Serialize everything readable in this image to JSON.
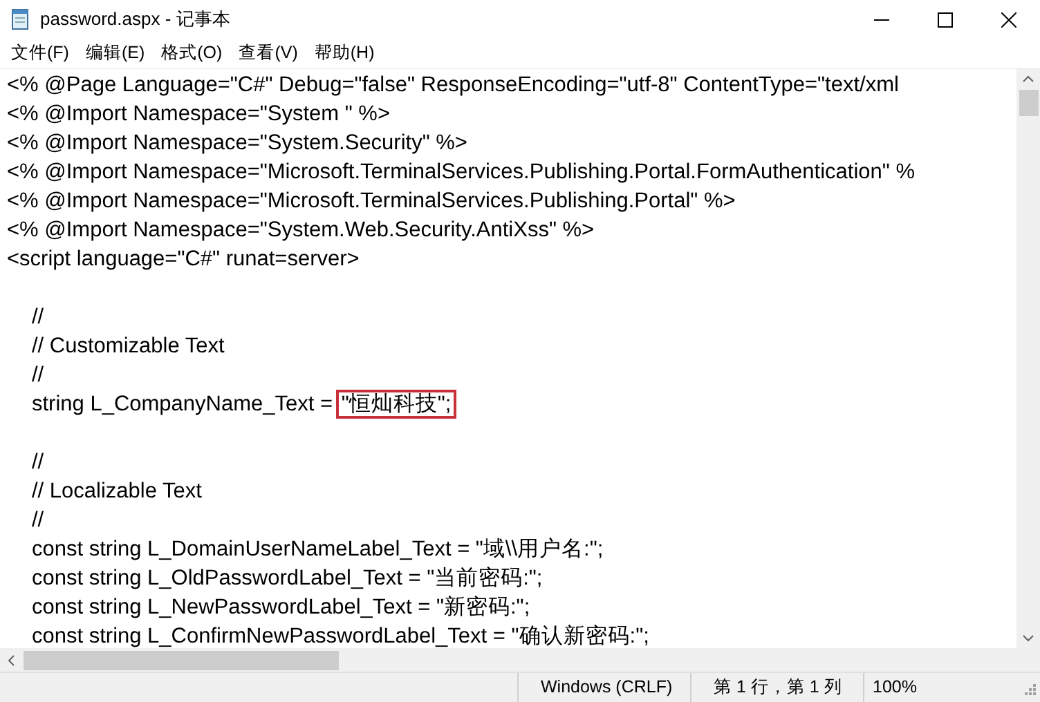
{
  "window": {
    "title": "password.aspx - 记事本"
  },
  "menu": [
    "文件(F)",
    "编辑(E)",
    "格式(O)",
    "查看(V)",
    "帮助(H)"
  ],
  "lines": [
    {
      "kind": "top",
      "text": "<% @Page Language=\"C#\" Debug=\"false\" ResponseEncoding=\"utf-8\" ContentType=\"text/xml"
    },
    {
      "kind": "top",
      "text": "<% @Import Namespace=\"System \" %>"
    },
    {
      "kind": "top",
      "text": "<% @Import Namespace=\"System.Security\" %>"
    },
    {
      "kind": "top",
      "text": "<% @Import Namespace=\"Microsoft.TerminalServices.Publishing.Portal.FormAuthentication\" %"
    },
    {
      "kind": "top",
      "text": "<% @Import Namespace=\"Microsoft.TerminalServices.Publishing.Portal\" %>"
    },
    {
      "kind": "top",
      "text": "<% @Import Namespace=\"System.Web.Security.AntiXss\" %>"
    },
    {
      "kind": "top",
      "text": "<script language=\"C#\" runat=server>"
    },
    {
      "kind": "blank"
    },
    {
      "kind": "inner",
      "text": "//"
    },
    {
      "kind": "inner",
      "text": "// Customizable Text"
    },
    {
      "kind": "inner",
      "text": "//"
    },
    {
      "kind": "inner",
      "text": "string L_CompanyName_Text = ",
      "highlight": "\"恒灿科技\";"
    },
    {
      "kind": "blank"
    },
    {
      "kind": "inner",
      "text": "//"
    },
    {
      "kind": "inner",
      "text": "// Localizable Text"
    },
    {
      "kind": "inner",
      "text": "//"
    },
    {
      "kind": "inner",
      "text": "const string L_DomainUserNameLabel_Text = \"域\\\\用户名:\";"
    },
    {
      "kind": "inner",
      "text": "const string L_OldPasswordLabel_Text = \"当前密码:\";"
    },
    {
      "kind": "inner",
      "text": "const string L_NewPasswordLabel_Text = \"新密码:\";"
    },
    {
      "kind": "inner",
      "text": "const string L_ConfirmNewPasswordLabel_Text = \"确认新密码:\";"
    }
  ],
  "status_bar": {
    "line_ending": "Windows (CRLF)",
    "position": "第 1 行，第 1 列",
    "zoom": "100%"
  }
}
